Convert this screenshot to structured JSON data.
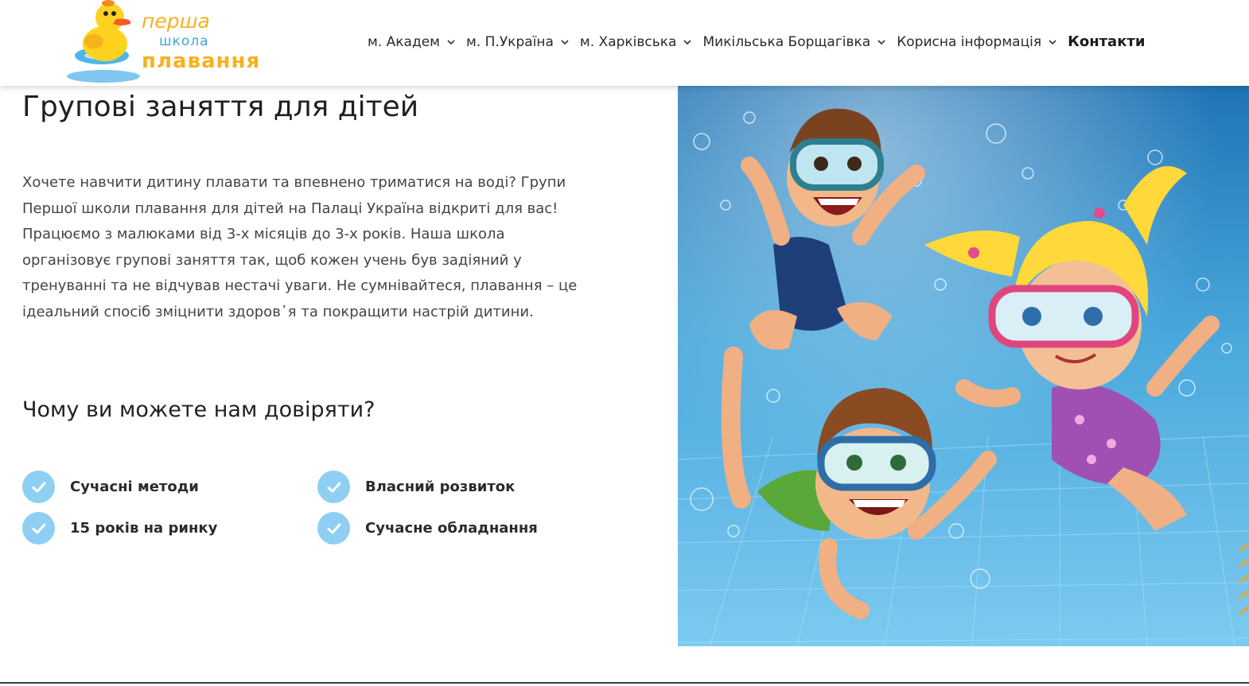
{
  "logo": {
    "line1": "перша",
    "line2": "школа",
    "line3": "плавання"
  },
  "nav": {
    "items": [
      {
        "label": "м. Академ"
      },
      {
        "label": "м. П.Україна"
      },
      {
        "label": "м. Харківська"
      },
      {
        "label": "Микільська Борщагівка"
      },
      {
        "label": "Корисна інформація"
      }
    ],
    "contacts": "Контакти"
  },
  "main": {
    "title": "Групові заняття для дітей",
    "intro": "Хочете навчити дитину плавати та впевнено триматися на воді? Групи Першої школи плавання для дітей на Палаці Україна відкриті для вас! Працюємо з малюками від 3-х місяців до 3-х років. Наша школа організовує групові заняття так, щоб кожен учень був задіяний у тренуванні та не відчував нестачі уваги. Не сумнівайтеся, плавання – це ідеальний спосіб зміцнити здоров᾽я та покращити настрій дитини.",
    "trust_title": "Чому ви можете нам довіряти?",
    "features": [
      {
        "label": "Сучасні методи"
      },
      {
        "label": "Власний розвиток"
      },
      {
        "label": "15 років на ринку"
      },
      {
        "label": "Сучасне обладнання"
      }
    ]
  },
  "colors": {
    "accent_check": "#8fcff3",
    "logo_yellow": "#f6b21d",
    "logo_blue": "#39a5de",
    "water": "#3f9ccf"
  },
  "icons": {
    "nav_dropdown": "chevron-down-icon",
    "feature": "check-circle-icon"
  }
}
